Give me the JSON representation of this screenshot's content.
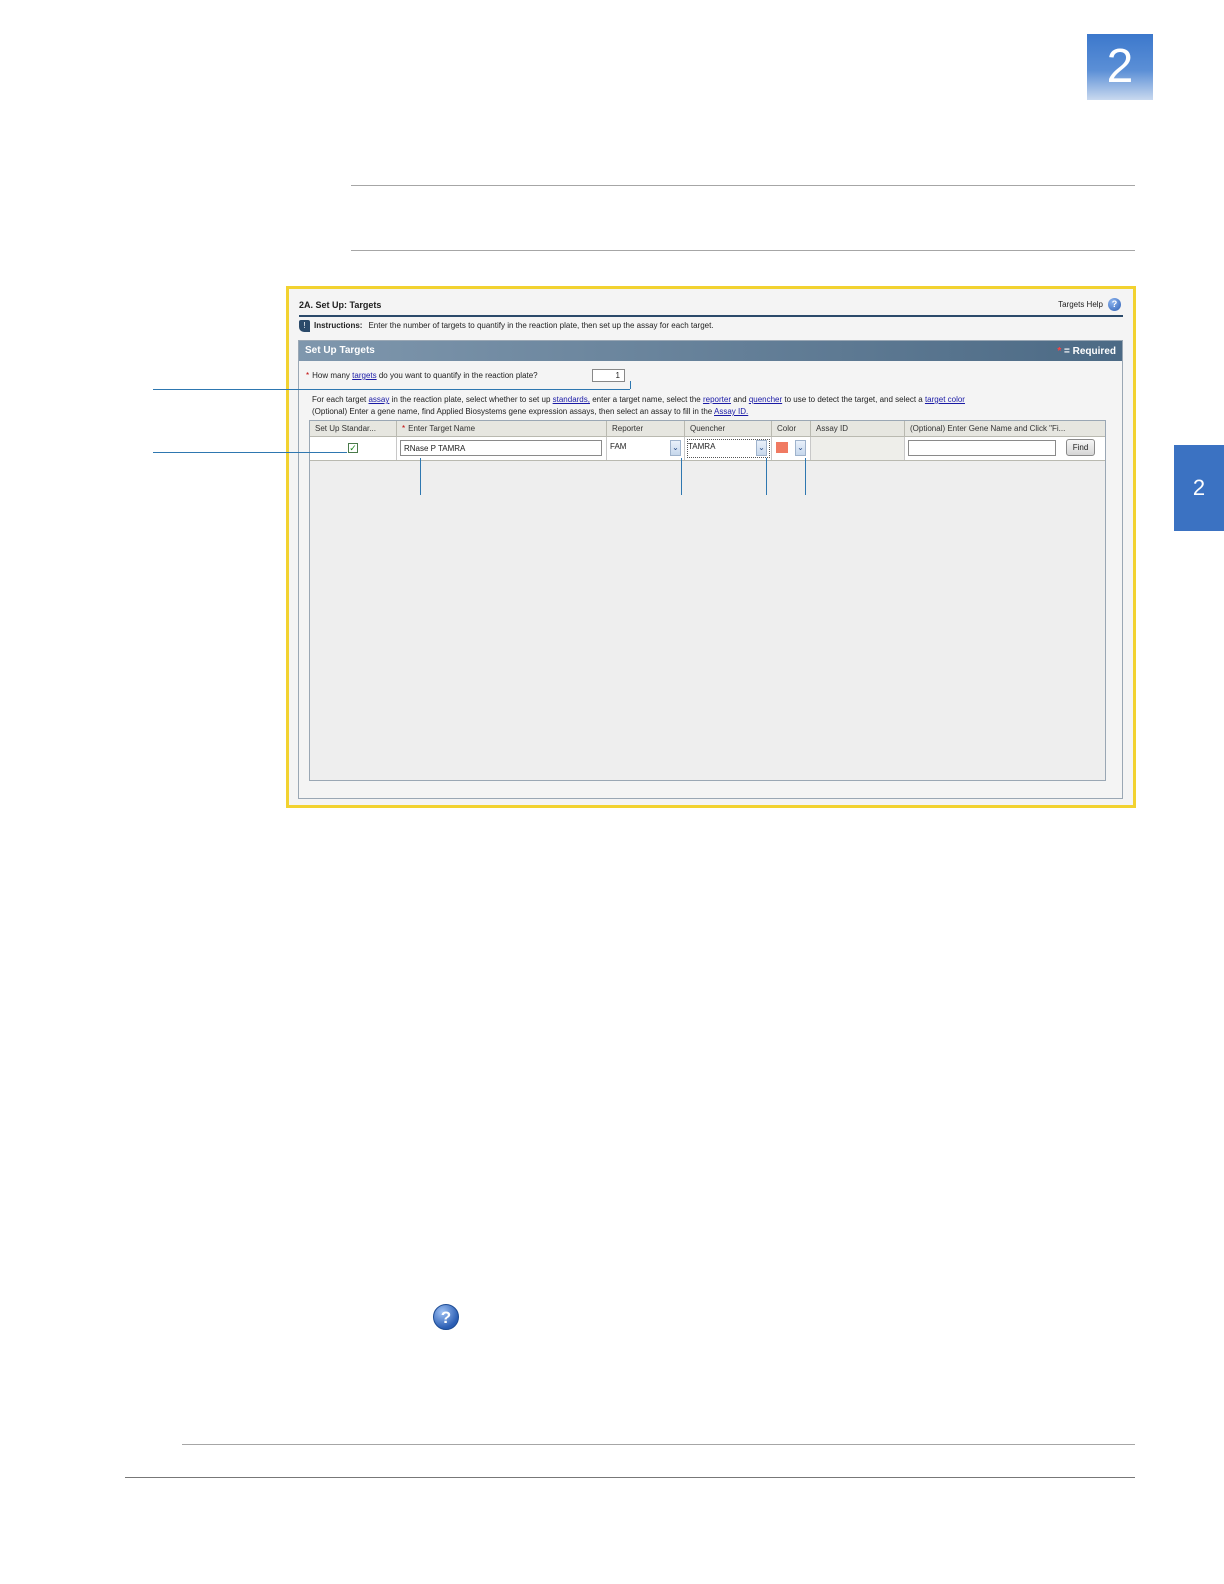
{
  "chapter_number": "2",
  "chapter_tab": "2",
  "screen": {
    "title": "2A. Set Up: Targets",
    "help_link": "Targets Help",
    "help_icon": "help-circle-icon",
    "instructions_label": "Instructions:",
    "instructions_text": "Enter the number of targets to quantify in the reaction plate, then set up the assay for each target.",
    "panel_title": "Set Up Targets",
    "required_legend": "= Required",
    "question_prefix": "How many",
    "question_link": "targets",
    "question_suffix": "do you want to quantify in the reaction plate?",
    "target_count": "1",
    "desc1": {
      "p1": "For each target",
      "l1": "assay",
      "p2": "in the reaction plate, select whether to set up",
      "l2": "standards,",
      "p3": "enter a target name, select the",
      "l3": "reporter",
      "p4": "and",
      "l4": "quencher",
      "p5": "to use to detect the target, and select a",
      "l5": "target color"
    },
    "desc2": {
      "p1": "(Optional) Enter a gene name, find Applied Biosystems gene expression assays, then select an assay to fill in the",
      "l1": "Assay ID."
    },
    "columns": {
      "standards": "Set Up Standar...",
      "target_name": "Enter Target Name",
      "reporter": "Reporter",
      "quencher": "Quencher",
      "color": "Color",
      "assay_id": "Assay ID",
      "gene": "(Optional) Enter Gene Name and Click \"Fi..."
    },
    "row": {
      "standards_checked": "✓",
      "target_name": "RNase P TAMRA",
      "reporter": "FAM",
      "quencher": "TAMRA",
      "color_hex": "#f07a62",
      "assay_id": "",
      "gene_name": "",
      "find_label": "Find"
    }
  },
  "bottom_help_icon": "help-circle-icon"
}
